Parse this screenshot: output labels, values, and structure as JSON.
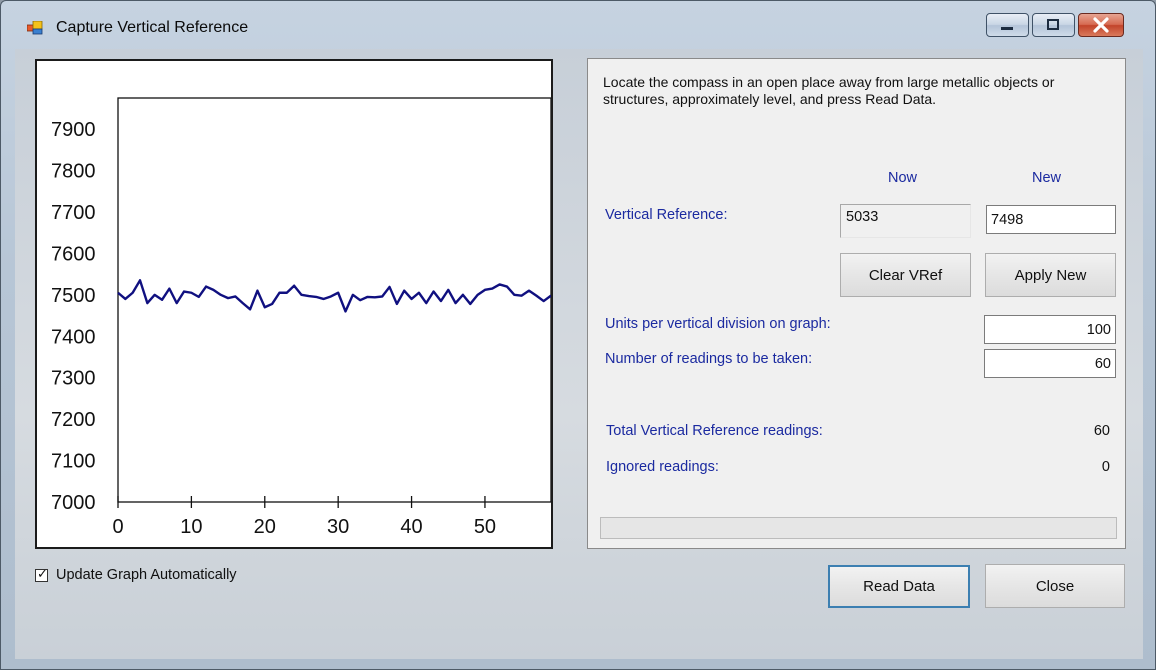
{
  "window": {
    "title": "Capture Vertical Reference"
  },
  "instructions": "Locate the compass in an open place away from large metallic objects or structures, approximately level, and press Read Data.",
  "columns": {
    "now": "Now",
    "new": "New"
  },
  "vertical_reference": {
    "label": "Vertical Reference:",
    "now_value": "5033",
    "new_value": "7498"
  },
  "buttons": {
    "clear_vref": "Clear VRef",
    "apply_new": "Apply New",
    "read_data": "Read Data",
    "close": "Close"
  },
  "settings": {
    "units_label": "Units per vertical division on graph:",
    "units_value": "100",
    "readings_label": "Number of readings to be taken:",
    "readings_value": "60"
  },
  "results": {
    "total_label": "Total Vertical Reference readings:",
    "total_value": "60",
    "ignored_label": "Ignored readings:",
    "ignored_value": "0"
  },
  "progress": {
    "value": 0
  },
  "options": {
    "update_graph_label": "Update Graph Automatically",
    "update_graph_checked": true
  },
  "chart_data": {
    "type": "line",
    "title": "",
    "xlabel": "",
    "ylabel": "",
    "xlim": [
      0,
      59
    ],
    "ylim": [
      7000,
      7975
    ],
    "x_ticks": [
      0,
      10,
      20,
      30,
      40,
      50
    ],
    "y_ticks": [
      7000,
      7100,
      7200,
      7300,
      7400,
      7500,
      7600,
      7700,
      7800,
      7900
    ],
    "grid": false,
    "line_color": "#101080",
    "x": [
      0,
      1,
      2,
      3,
      4,
      5,
      6,
      7,
      8,
      9,
      10,
      11,
      12,
      13,
      14,
      15,
      16,
      17,
      18,
      19,
      20,
      21,
      22,
      23,
      24,
      25,
      26,
      27,
      28,
      29,
      30,
      31,
      32,
      33,
      34,
      35,
      36,
      37,
      38,
      39,
      40,
      41,
      42,
      43,
      44,
      45,
      46,
      47,
      48,
      49,
      50,
      51,
      52,
      53,
      54,
      55,
      56,
      57,
      58,
      59
    ],
    "values": [
      7505,
      7490,
      7505,
      7535,
      7480,
      7500,
      7488,
      7515,
      7480,
      7508,
      7505,
      7495,
      7520,
      7512,
      7500,
      7492,
      7496,
      7480,
      7465,
      7510,
      7470,
      7478,
      7505,
      7505,
      7522,
      7500,
      7497,
      7495,
      7490,
      7496,
      7505,
      7460,
      7500,
      7487,
      7495,
      7494,
      7496,
      7519,
      7478,
      7510,
      7490,
      7505,
      7480,
      7508,
      7485,
      7512,
      7480,
      7500,
      7478,
      7500,
      7512,
      7515,
      7525,
      7520,
      7500,
      7498,
      7510,
      7498,
      7485,
      7498
    ]
  }
}
